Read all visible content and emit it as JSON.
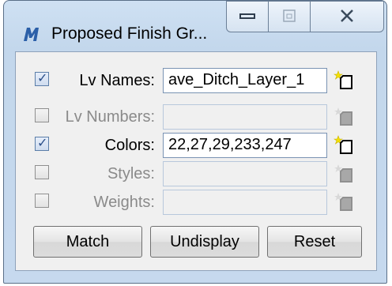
{
  "window": {
    "title": "Proposed Finish Gr..."
  },
  "rows": [
    {
      "label": "Lv Names:",
      "checked": true,
      "enabled": true,
      "value": "ave_Ditch_Layer_1"
    },
    {
      "label": "Lv Numbers:",
      "checked": false,
      "enabled": false,
      "value": ""
    },
    {
      "label": "Colors:",
      "checked": true,
      "enabled": true,
      "value": "22,27,29,233,247"
    },
    {
      "label": "Styles:",
      "checked": false,
      "enabled": false,
      "value": ""
    },
    {
      "label": "Weights:",
      "checked": false,
      "enabled": false,
      "value": ""
    }
  ],
  "buttons": {
    "match": "Match",
    "undisplay": "Undisplay",
    "reset": "Reset"
  },
  "icons": {
    "app": "microstation-icon",
    "pick": "pick-element-icon"
  },
  "colors": {
    "accent": "#2b4f8a",
    "spark": "#f5e000"
  }
}
